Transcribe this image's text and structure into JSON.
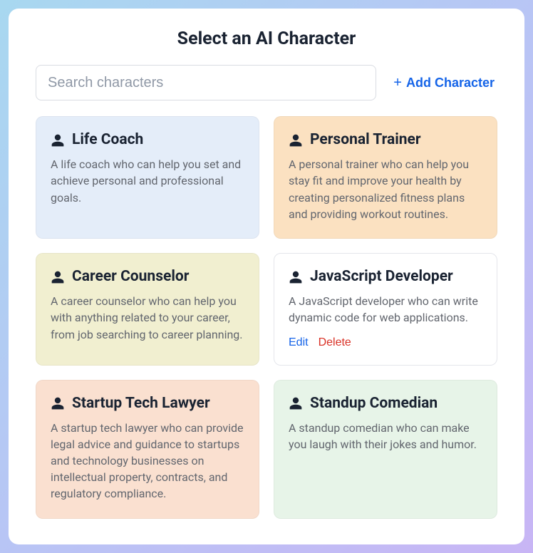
{
  "modal": {
    "title": "Select an AI Character"
  },
  "toolbar": {
    "search_placeholder": "Search characters",
    "add_label": "Add Character"
  },
  "actions": {
    "edit": "Edit",
    "delete": "Delete"
  },
  "cards": [
    {
      "title": "Life Coach",
      "description": "A life coach who can help you set and achieve personal and professional goals.",
      "color": "blue",
      "show_actions": false
    },
    {
      "title": "Personal Trainer",
      "description": "A personal trainer who can help you stay fit and improve your health by creating personalized fitness plans and providing workout routines.",
      "color": "orange",
      "show_actions": false
    },
    {
      "title": "Career Counselor",
      "description": "A career counselor who can help you with anything related to your career, from job searching to career planning.",
      "color": "yellow",
      "show_actions": false
    },
    {
      "title": "JavaScript Developer",
      "description": "A JavaScript developer who can write dynamic code for web applications.",
      "color": "white",
      "show_actions": true
    },
    {
      "title": "Startup Tech Lawyer",
      "description": "A startup tech lawyer who can provide legal advice and guidance to startups and technology businesses on intellectual property, contracts, and regulatory compliance.",
      "color": "peach",
      "show_actions": false
    },
    {
      "title": "Standup Comedian",
      "description": "A standup comedian who can make you laugh with their jokes and humor.",
      "color": "green",
      "show_actions": false
    }
  ]
}
